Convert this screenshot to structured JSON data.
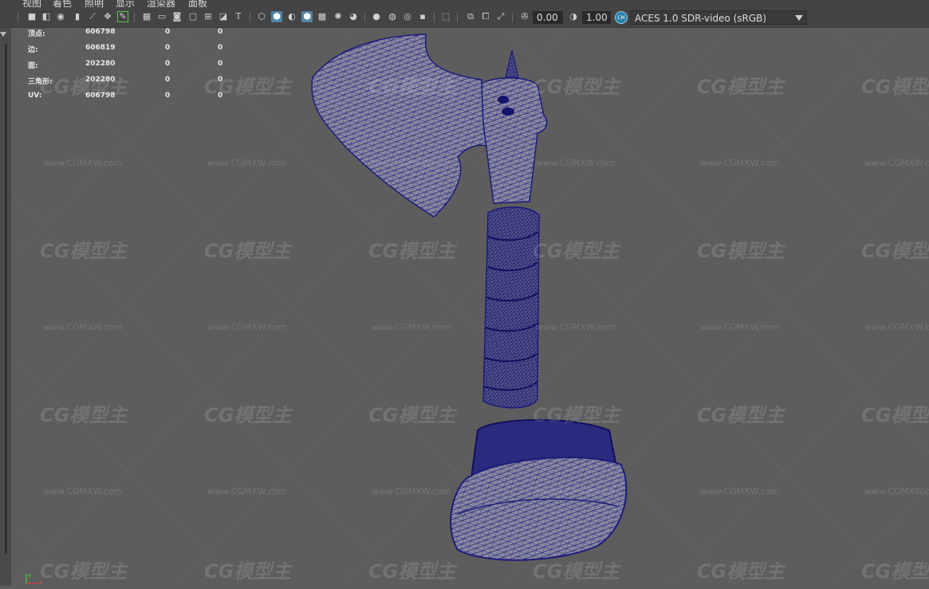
{
  "menubar": {
    "items": [
      "视图",
      "着色",
      "照明",
      "显示",
      "渲染器",
      "面板"
    ]
  },
  "toolbar": {
    "exposure_value": "0.00",
    "gamma_value": "1.00",
    "colorspace_icon_text": "CM",
    "colorspace_value": "ACES 1.0 SDR-video (sRGB)"
  },
  "hud": {
    "rows": [
      {
        "label": "顶点:",
        "v1": "606798",
        "v2": "0",
        "v3": "0"
      },
      {
        "label": "边:",
        "v1": "606819",
        "v2": "0",
        "v3": "0"
      },
      {
        "label": "面:",
        "v1": "202280",
        "v2": "0",
        "v3": "0"
      },
      {
        "label": "三角形:",
        "v1": "202280",
        "v2": "0",
        "v3": "0"
      },
      {
        "label": "UV:",
        "v1": "606798",
        "v2": "0",
        "v3": "0"
      }
    ]
  },
  "axis": {
    "x_label": "x",
    "y_label": "y"
  },
  "watermark": {
    "logo": "CG模型主",
    "url": "www.CGMXW.com"
  },
  "colors": {
    "viewport_bg": "#5d5d5d",
    "wireframe": "#1c1c7a",
    "toolbar_bg": "#444444",
    "active_button": "#5285a6"
  },
  "icons": {
    "viewport_tools": [
      "camera-icon",
      "camera-attributes-icon",
      "bookmark-icon",
      "grid-icon",
      "film-gate-icon",
      "resolution-gate-icon",
      "safe-action-icon",
      "wireframe-cube-icon",
      "smooth-shade-icon",
      "xray-icon",
      "light-icon",
      "shadow-icon",
      "isolate-select-icon",
      "exposure-icon",
      "gamma-icon",
      "color-management-icon"
    ]
  }
}
